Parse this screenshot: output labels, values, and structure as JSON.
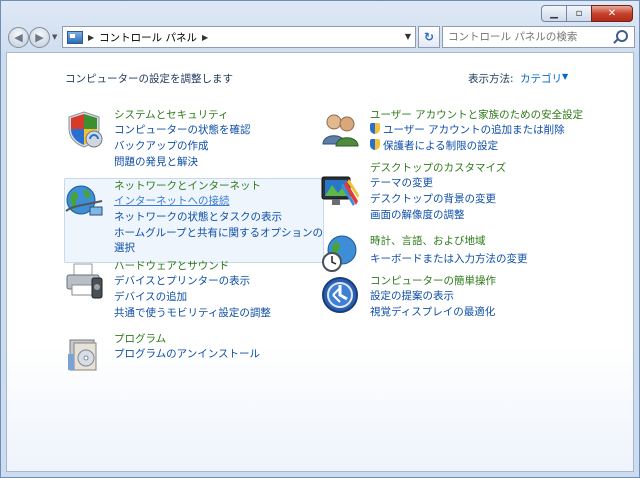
{
  "nav": {
    "address_path": "コントロール パネル",
    "search_placeholder": "コントロール パネルの検索"
  },
  "header": {
    "title": "コンピューターの設定を調整します",
    "viewby_label": "表示方法:",
    "viewby_value": "カテゴリ"
  },
  "left": [
    {
      "head": "システムとセキュリティ",
      "links": [
        "コンピューターの状態を確認",
        "バックアップの作成",
        "問題の発見と解決"
      ]
    },
    {
      "head": "ネットワークとインターネット",
      "links": [
        "インターネットへの接続",
        "ネットワークの状態とタスクの表示",
        "ホームグループと共有に関するオプションの",
        "選択"
      ]
    },
    {
      "head": "ハードウェアとサウンド",
      "links": [
        "デバイスとプリンターの表示",
        "デバイスの追加",
        "共通で使うモビリティ設定の調整"
      ]
    },
    {
      "head": "プログラム",
      "links": [
        "プログラムのアンインストール"
      ]
    }
  ],
  "right": [
    {
      "head": "ユーザー アカウントと家族のための安全設定",
      "links": [
        "ユーザー アカウントの追加または削除",
        "保護者による制限の設定"
      ]
    },
    {
      "head": "デスクトップのカスタマイズ",
      "links": [
        "テーマの変更",
        "デスクトップの背景の変更",
        "画面の解像度の調整"
      ]
    },
    {
      "head": "時計、言語、および地域",
      "links": [
        "キーボードまたは入力方法の変更"
      ]
    },
    {
      "head": "コンピューターの簡単操作",
      "links": [
        "設定の提案の表示",
        "視覚ディスプレイの最適化"
      ]
    }
  ],
  "icons": [
    "shield-icon",
    "network-globe-icon",
    "printer-icon",
    "programs-box-icon",
    "users-icon",
    "display-icon",
    "clock-globe-icon",
    "ease-of-access-icon"
  ]
}
